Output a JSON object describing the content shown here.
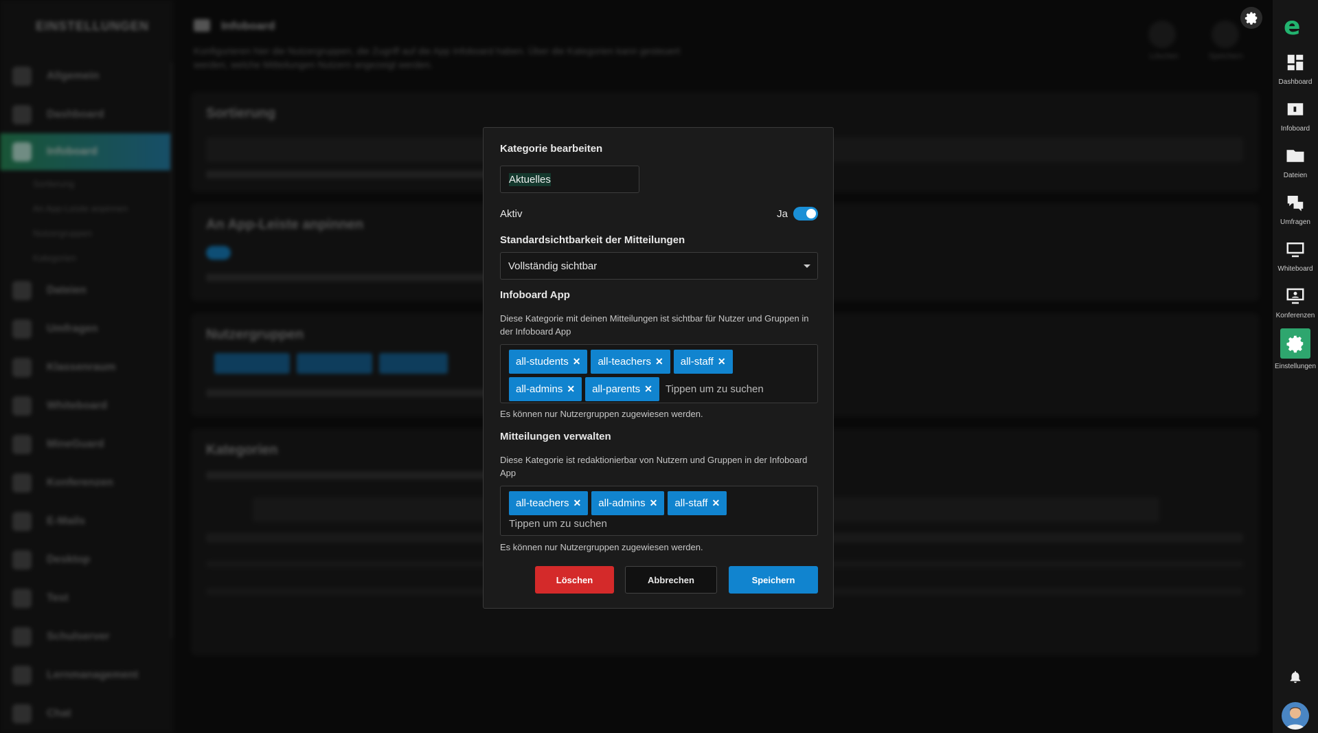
{
  "background": {
    "sidebar": {
      "title": "EINSTELLUNGEN",
      "items": [
        "Allgemein",
        "Dashboard",
        "Infoboard",
        "Dateien",
        "Umfragen",
        "Klassenraum",
        "Whiteboard",
        "MineGuard",
        "Konferenzen",
        "E-Mails",
        "Desktop",
        "Test",
        "Schulserver",
        "Lernmanagement",
        "Chat"
      ],
      "subitems": [
        "Sortierung",
        "An App-Leiste anpinnen",
        "Nutzergruppen",
        "Kategorien"
      ]
    },
    "main": {
      "title": "Infoboard",
      "description": "Konfigurieren hier die Nutzergruppen, die Zugriff auf die App Infoboard haben. Über die Kategorien kann gesteuert werden, welche Mitteilungen Nutzern angezeigt werden.",
      "actions": [
        "Löschen",
        "Speichern"
      ],
      "sections": [
        "Sortierung",
        "An App-Leiste anpinnen",
        "Nutzergruppen",
        "Kategorien"
      ]
    },
    "rightbar": {
      "items": [
        "Dashboard",
        "Infoboard",
        "Dateien",
        "Umfragen",
        "Whiteboard",
        "Konferenzen",
        "Einstellungen"
      ]
    }
  },
  "modal": {
    "title": "Kategorie bearbeiten",
    "name_value": "Aktuelles",
    "aktiv_label": "Aktiv",
    "aktiv_value": "Ja",
    "aktiv_on": true,
    "visibility_label": "Standardsichtbarkeit der Mitteilungen",
    "visibility_value": "Vollständig sichtbar",
    "app_label": "Infoboard App",
    "app_help": "Diese Kategorie mit deinen Mitteilungen ist sichtbar für Nutzer und Gruppen in der Infoboard App",
    "app_groups_row1": [
      "all-students",
      "all-teachers",
      "all-staff"
    ],
    "app_groups_row2": [
      "all-admins",
      "all-parents"
    ],
    "search_placeholder": "Tippen um zu suchen",
    "groups_note": "Es können nur Nutzergruppen zugewiesen werden.",
    "manage_label": "Mitteilungen verwalten",
    "manage_help": "Diese Kategorie ist redaktionierbar von Nutzern und Gruppen in der Infoboard App",
    "manage_groups": [
      "all-teachers",
      "all-admins",
      "all-staff"
    ],
    "buttons": {
      "delete": "Löschen",
      "cancel": "Abbrechen",
      "save": "Speichern"
    }
  },
  "colors": {
    "accent": "#1184cf",
    "danger": "#d42a2a",
    "brand": "#22b36f"
  }
}
